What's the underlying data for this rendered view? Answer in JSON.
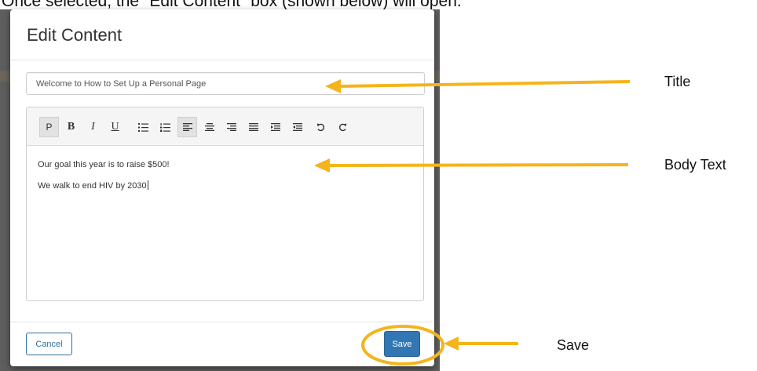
{
  "intro_text": "Once selected, the \"Edit Content\" box (shown below) will open.",
  "modal": {
    "title": "Edit Content",
    "title_field_value": "Welcome to How to Set Up a Personal Page",
    "toolbar": [
      {
        "name": "paragraph",
        "glyph": "P"
      },
      {
        "name": "bold",
        "glyph": "B"
      },
      {
        "name": "italic",
        "glyph": "I"
      },
      {
        "name": "underline",
        "glyph": "U"
      },
      {
        "name": "bullet-list-icon"
      },
      {
        "name": "numbered-list-icon"
      },
      {
        "name": "align-left-icon"
      },
      {
        "name": "align-center-icon"
      },
      {
        "name": "align-right-icon"
      },
      {
        "name": "align-justify-icon"
      },
      {
        "name": "indent-icon"
      },
      {
        "name": "outdent-icon"
      },
      {
        "name": "undo-icon"
      },
      {
        "name": "redo-icon"
      }
    ],
    "body_lines": [
      "Our goal this year is to raise $500!",
      "We walk to end HIV by 2030"
    ],
    "cancel_label": "Cancel",
    "save_label": "Save"
  },
  "annotations": {
    "title_label": "Title",
    "body_label": "Body Text",
    "save_label": "Save",
    "arrow_color": "#f5b41c"
  }
}
